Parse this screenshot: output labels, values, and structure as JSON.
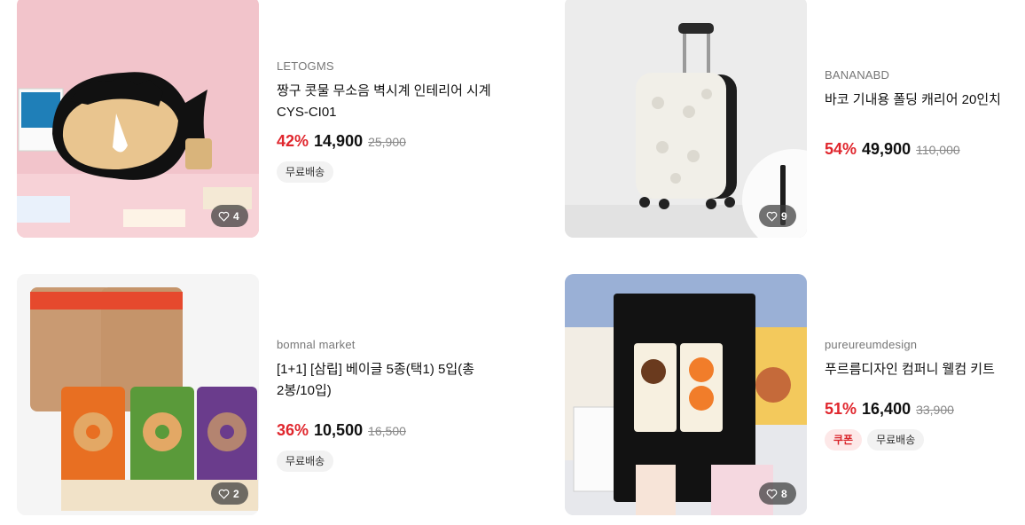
{
  "products": [
    {
      "brand": "LETOGMS",
      "title": "짱구 콧물 무소음 벽시계 인테리어 시계 CYS-CI01",
      "discount": "42%",
      "price": "14,900",
      "original": "25,900",
      "tags": [
        "무료배송"
      ],
      "likes": "4"
    },
    {
      "brand": "BANANABD",
      "title": "바코 기내용 폴딩 캐리어 20인치",
      "discount": "54%",
      "price": "49,900",
      "original": "110,000",
      "tags": [],
      "likes": "9"
    },
    {
      "brand": "bomnal market",
      "title": "[1+1] [삼립] 베이글 5종(택1) 5입(총 2봉/10입)",
      "discount": "36%",
      "price": "10,500",
      "original": "16,500",
      "tags": [
        "무료배송"
      ],
      "likes": "2"
    },
    {
      "brand": "pureureumdesign",
      "title": "푸르름디자인 컴퍼니 웰컴 키트",
      "discount": "51%",
      "price": "16,400",
      "original": "33,900",
      "tags": [
        "쿠폰",
        "무료배송"
      ],
      "likes": "8"
    }
  ],
  "colors": {
    "discount": "#e0262d",
    "coupon": "#d9252b"
  }
}
